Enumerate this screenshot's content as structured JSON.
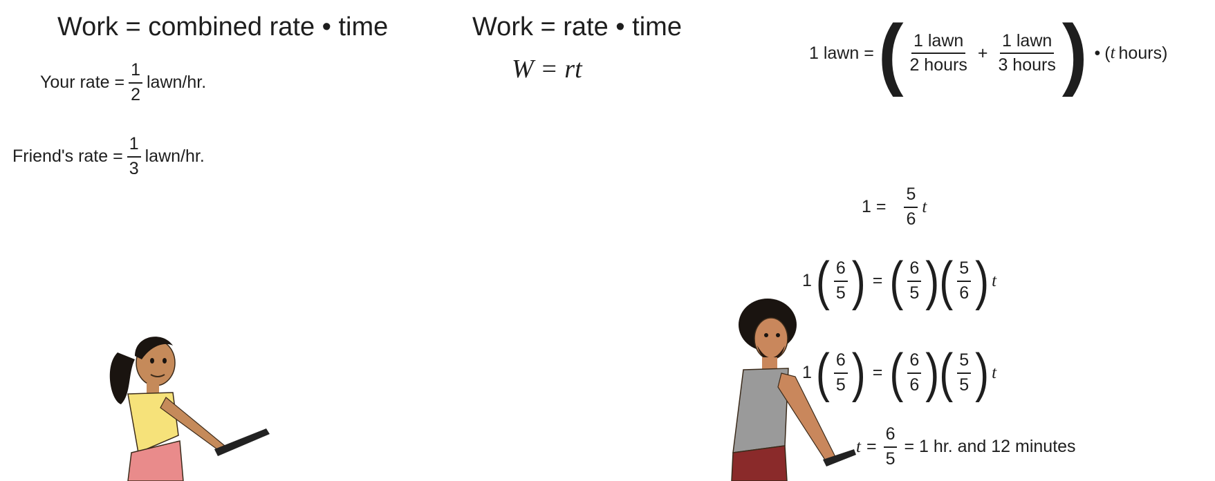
{
  "left": {
    "heading": "Work = combined rate • time",
    "your_rate": {
      "label": "Your rate =",
      "num": "1",
      "den": "2",
      "unit": "lawn/hr."
    },
    "friend_rate": {
      "label": "Friend's rate =",
      "num": "1",
      "den": "3",
      "unit": "lawn/hr."
    }
  },
  "middle": {
    "heading": "Work = rate • time",
    "formula": "W = rt"
  },
  "right": {
    "eq1": {
      "lhs": "1 lawn =",
      "f1_num": "1 lawn",
      "f1_den": "2 hours",
      "plus": "+",
      "f2_num": "1 lawn",
      "f2_den": "3 hours",
      "tail_dot": "•",
      "tail_open": "(",
      "tail_var": "t",
      "tail_text": "hours)"
    },
    "eq2": {
      "lhs": "1 =",
      "num": "5",
      "den": "6",
      "var": "t"
    },
    "eq3": {
      "lead": "1",
      "a_num": "6",
      "a_den": "5",
      "eq": "=",
      "b_num": "6",
      "b_den": "5",
      "c_num": "5",
      "c_den": "6",
      "var": "t"
    },
    "eq4": {
      "lead": "1",
      "a_num": "6",
      "a_den": "5",
      "eq": "=",
      "b_num": "6",
      "b_den": "6",
      "c_num": "5",
      "c_den": "5",
      "var": "t"
    },
    "eq5": {
      "var": "t",
      "eq": "=",
      "num": "6",
      "den": "5",
      "result": "= 1 hr. and 12 minutes"
    }
  },
  "colors": {
    "text": "#1e1e1e",
    "girl_shirt": "#f6e27a",
    "girl_shorts": "#e98b8b",
    "boy_shirt": "#9a9a9a",
    "skin_girl": "#c58a5a",
    "skin_boy": "#c9875c",
    "hair": "#1a1410"
  },
  "icons": [
    "girl-pushing-mower-illustration",
    "boy-pushing-mower-illustration"
  ]
}
